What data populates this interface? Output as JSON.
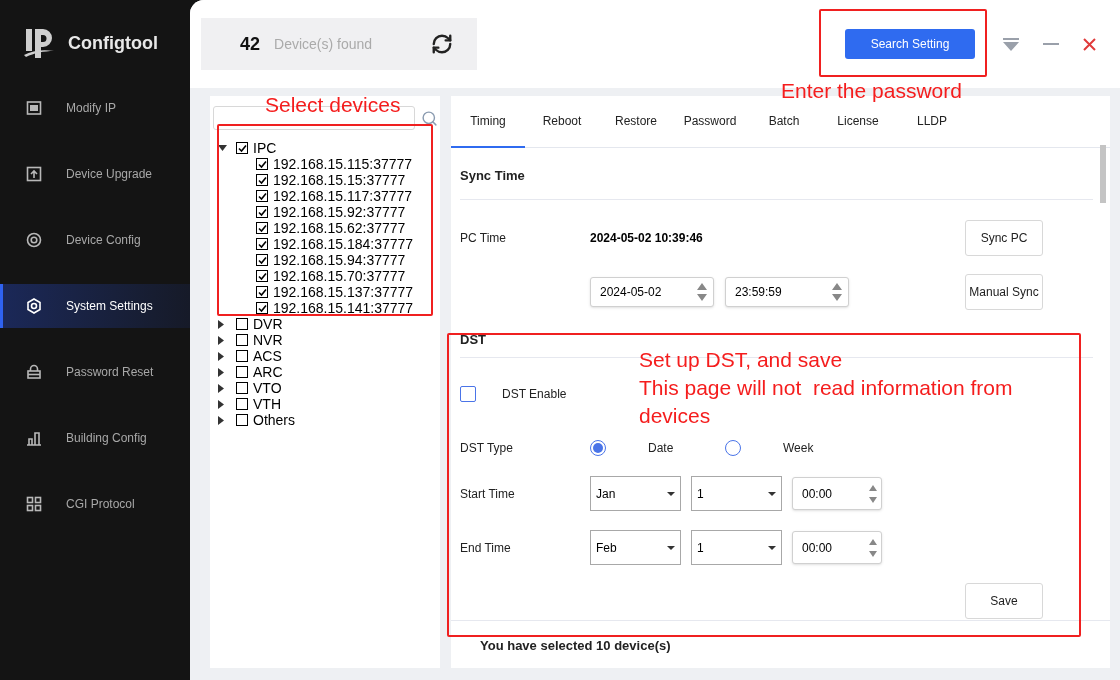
{
  "app": {
    "name": "Configtool"
  },
  "sidebar": {
    "items": [
      {
        "label": "Modify IP",
        "selected": false
      },
      {
        "label": "Device Upgrade",
        "selected": false
      },
      {
        "label": "Device Config",
        "selected": false
      },
      {
        "label": "System Settings",
        "selected": true
      },
      {
        "label": "Password Reset",
        "selected": false
      },
      {
        "label": "Building Config",
        "selected": false
      },
      {
        "label": "CGI Protocol",
        "selected": false
      }
    ]
  },
  "header": {
    "device_count": "42",
    "count_label": "Device(s) found",
    "search_button": "Search Setting"
  },
  "device_tree": {
    "groups": [
      {
        "label": "IPC",
        "expanded": true,
        "checked": true,
        "children": [
          {
            "label": "192.168.15.115:37777",
            "checked": true
          },
          {
            "label": "192.168.15.15:37777",
            "checked": true
          },
          {
            "label": "192.168.15.117:37777",
            "checked": true
          },
          {
            "label": "192.168.15.92:37777",
            "checked": true
          },
          {
            "label": "192.168.15.62:37777",
            "checked": true
          },
          {
            "label": "192.168.15.184:37777",
            "checked": true
          },
          {
            "label": "192.168.15.94:37777",
            "checked": true
          },
          {
            "label": "192.168.15.70:37777",
            "checked": true
          },
          {
            "label": "192.168.15.137:37777",
            "checked": true
          },
          {
            "label": "192.168.15.141:37777",
            "checked": true
          }
        ]
      },
      {
        "label": "DVR",
        "expanded": false,
        "checked": false
      },
      {
        "label": "NVR",
        "expanded": false,
        "checked": false
      },
      {
        "label": "ACS",
        "expanded": false,
        "checked": false
      },
      {
        "label": "ARC",
        "expanded": false,
        "checked": false
      },
      {
        "label": "VTO",
        "expanded": false,
        "checked": false
      },
      {
        "label": "VTH",
        "expanded": false,
        "checked": false
      },
      {
        "label": "Others",
        "expanded": false,
        "checked": false
      }
    ]
  },
  "tabs": [
    {
      "label": "Timing",
      "selected": true
    },
    {
      "label": "Reboot",
      "selected": false
    },
    {
      "label": "Restore",
      "selected": false
    },
    {
      "label": "Password",
      "selected": false
    },
    {
      "label": "Batch",
      "selected": false
    },
    {
      "label": "License",
      "selected": false
    },
    {
      "label": "LLDP",
      "selected": false
    }
  ],
  "sync_time": {
    "title": "Sync Time",
    "pc_time_label": "PC Time",
    "pc_time": "2024-05-02 10:39:46",
    "sync_pc_button": "Sync PC",
    "date": "2024-05-02",
    "time": "23:59:59",
    "manual_sync_button": "Manual Sync"
  },
  "dst": {
    "title": "DST",
    "enable": {
      "label": "DST Enable",
      "checked": false
    },
    "type_label": "DST Type",
    "types": [
      {
        "label": "Date",
        "selected": true
      },
      {
        "label": "Week",
        "selected": false
      }
    ],
    "start": {
      "label": "Start Time",
      "month": "Jan",
      "day": "1",
      "time": "00:00"
    },
    "end": {
      "label": "End Time",
      "month": "Feb",
      "day": "1",
      "time": "00:00"
    },
    "save_button": "Save"
  },
  "status": "You have selected 10 device(s)",
  "annotations": [
    {
      "lines": [
        "Enter the password"
      ]
    },
    {
      "lines": [
        "Select devices"
      ]
    },
    {
      "lines": [
        "Set up DST, and save",
        "This page will not  read information from devices"
      ]
    }
  ]
}
